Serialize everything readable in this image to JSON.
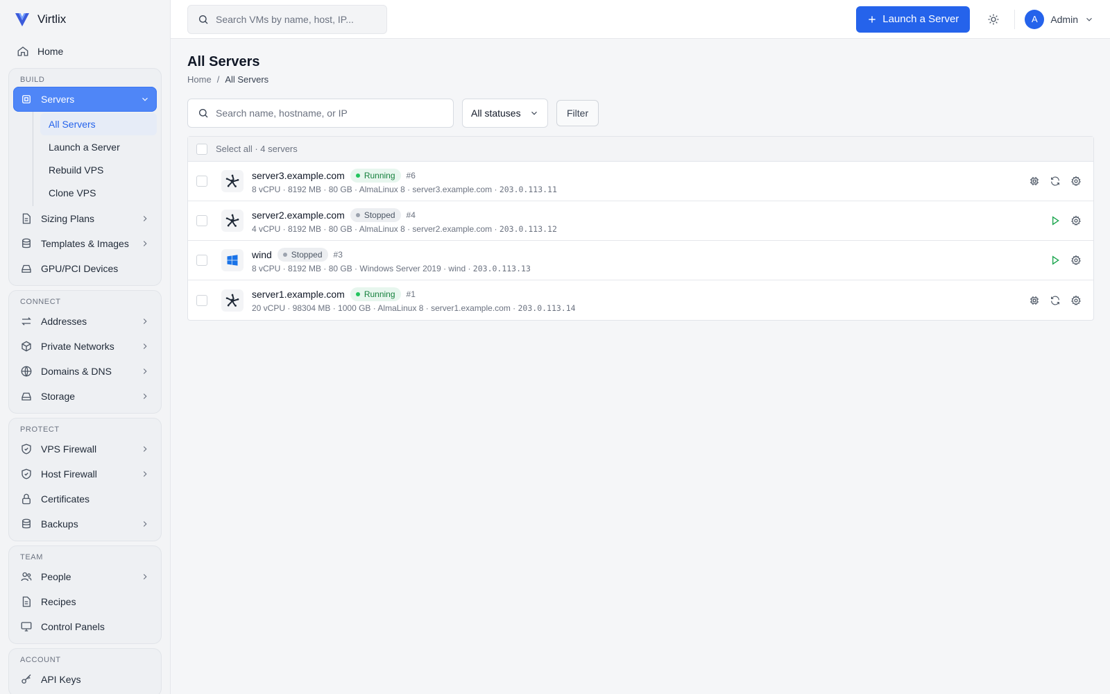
{
  "app": {
    "name": "Virtlix"
  },
  "colors": {
    "accent": "#2563eb",
    "running": "#22c55e",
    "stopped": "#9ca3af"
  },
  "sidebar": {
    "home": "Home",
    "groups": [
      {
        "title": "BUILD",
        "items": [
          {
            "label": "Servers",
            "icon": "server-icon",
            "expanded": true,
            "children": [
              "All Servers",
              "Launch a Server",
              "Rebuild VPS",
              "Clone VPS"
            ]
          },
          {
            "label": "Sizing Plans",
            "icon": "document-icon"
          },
          {
            "label": "Templates & Images",
            "icon": "stack-icon"
          },
          {
            "label": "GPU/PCI Devices",
            "icon": "drive-icon"
          }
        ]
      },
      {
        "title": "CONNECT",
        "items": [
          {
            "label": "Addresses",
            "icon": "arrows-icon"
          },
          {
            "label": "Private Networks",
            "icon": "cube-icon"
          },
          {
            "label": "Domains & DNS",
            "icon": "globe-icon"
          },
          {
            "label": "Storage",
            "icon": "drive-icon"
          }
        ]
      },
      {
        "title": "PROTECT",
        "items": [
          {
            "label": "VPS Firewall",
            "icon": "shield-icon"
          },
          {
            "label": "Host Firewall",
            "icon": "shield-icon"
          },
          {
            "label": "Certificates",
            "icon": "lock-icon"
          },
          {
            "label": "Backups",
            "icon": "database-icon"
          }
        ]
      },
      {
        "title": "TEAM",
        "items": [
          {
            "label": "People",
            "icon": "users-icon"
          },
          {
            "label": "Recipes",
            "icon": "document-icon"
          },
          {
            "label": "Control Panels",
            "icon": "monitor-icon"
          }
        ]
      },
      {
        "title": "ACCOUNT",
        "items": [
          {
            "label": "API Keys",
            "icon": "key-icon"
          }
        ]
      }
    ]
  },
  "topbar": {
    "search_placeholder": "Search VMs by name, host, IP...",
    "launch_label": "Launch a Server",
    "user_initial": "A",
    "user_name": "Admin"
  },
  "page": {
    "title": "All Servers",
    "breadcrumb": [
      "Home",
      "All Servers"
    ],
    "search_placeholder": "Search name, hostname, or IP",
    "status_select": "All statuses",
    "filter_label": "Filter",
    "select_all": "Select all · 4 servers"
  },
  "servers": [
    {
      "name": "server3.example.com",
      "status": "Running",
      "id": "#6",
      "os": "alma",
      "specs": "8 vCPU · 8192 MB · 80 GB · AlmaLinux 8 · server3.example.com ·",
      "ip": "203.0.113.11"
    },
    {
      "name": "server2.example.com",
      "status": "Stopped",
      "id": "#4",
      "os": "alma",
      "specs": "4 vCPU · 8192 MB · 80 GB · AlmaLinux 8 · server2.example.com ·",
      "ip": "203.0.113.12"
    },
    {
      "name": "wind",
      "status": "Stopped",
      "id": "#3",
      "os": "windows",
      "specs": "8 vCPU · 8192 MB · 80 GB · Windows Server 2019 · wind ·",
      "ip": "203.0.113.13"
    },
    {
      "name": "server1.example.com",
      "status": "Running",
      "id": "#1",
      "os": "alma",
      "specs": "20 vCPU · 98304 MB · 1000 GB · AlmaLinux 8 · server1.example.com ·",
      "ip": "203.0.113.14"
    }
  ]
}
